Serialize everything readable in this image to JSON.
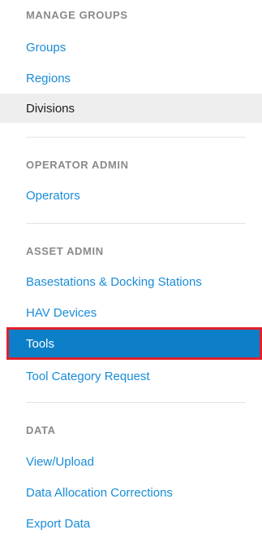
{
  "sections": [
    {
      "header": "MANAGE GROUPS",
      "items": [
        "Groups",
        "Regions",
        "Divisions"
      ]
    },
    {
      "header": "OPERATOR ADMIN",
      "items": [
        "Operators"
      ]
    },
    {
      "header": "ASSET ADMIN",
      "items": [
        "Basestations & Docking Stations",
        "HAV Devices",
        "Tools",
        "Tool Category Request"
      ]
    },
    {
      "header": "DATA",
      "items": [
        "View/Upload",
        "Data Allocation Corrections",
        "Export Data"
      ]
    }
  ],
  "colors": {
    "link": "#1a8cd8",
    "header": "#8a8a8a",
    "active_grey_bg": "#eeeeee",
    "selected_bg": "#0d7fc9",
    "highlight_border": "#e0202c"
  }
}
